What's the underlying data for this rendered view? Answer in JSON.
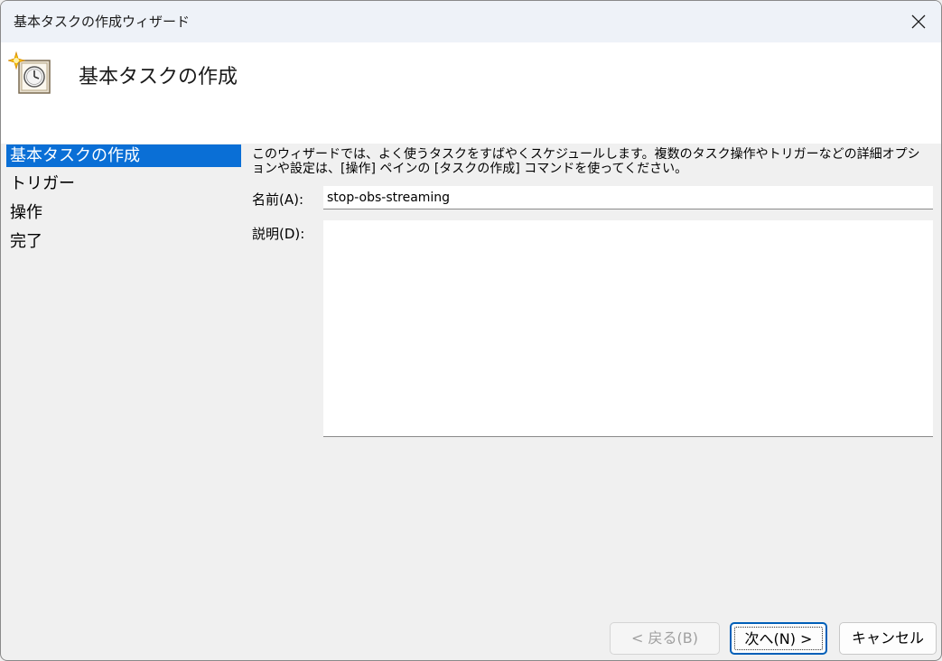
{
  "window": {
    "title": "基本タスクの作成ウィザード"
  },
  "header": {
    "title": "基本タスクの作成",
    "icon": "scheduled-task-clock-icon"
  },
  "steps": [
    {
      "label": "基本タスクの作成",
      "active": true
    },
    {
      "label": "トリガー",
      "active": false
    },
    {
      "label": "操作",
      "active": false
    },
    {
      "label": "完了",
      "active": false
    }
  ],
  "content": {
    "description_line1": "このウィザードでは、よく使うタスクをすばやくスケジュールします。複数のタスク操作やトリガーなどの詳細オプシ",
    "description_line2": "ョンや設定は、[操作] ペインの [タスクの作成] コマンドを使ってください。",
    "name_label": "名前(A):",
    "name_value": "stop-obs-streaming",
    "desc_label": "説明(D):",
    "desc_value": ""
  },
  "buttons": {
    "back": "< 戻る(B)",
    "next": "次へ(N) >",
    "cancel": "キャンセル"
  },
  "colors": {
    "accent": "#0a6fd6",
    "button_focus": "#005fb8"
  }
}
